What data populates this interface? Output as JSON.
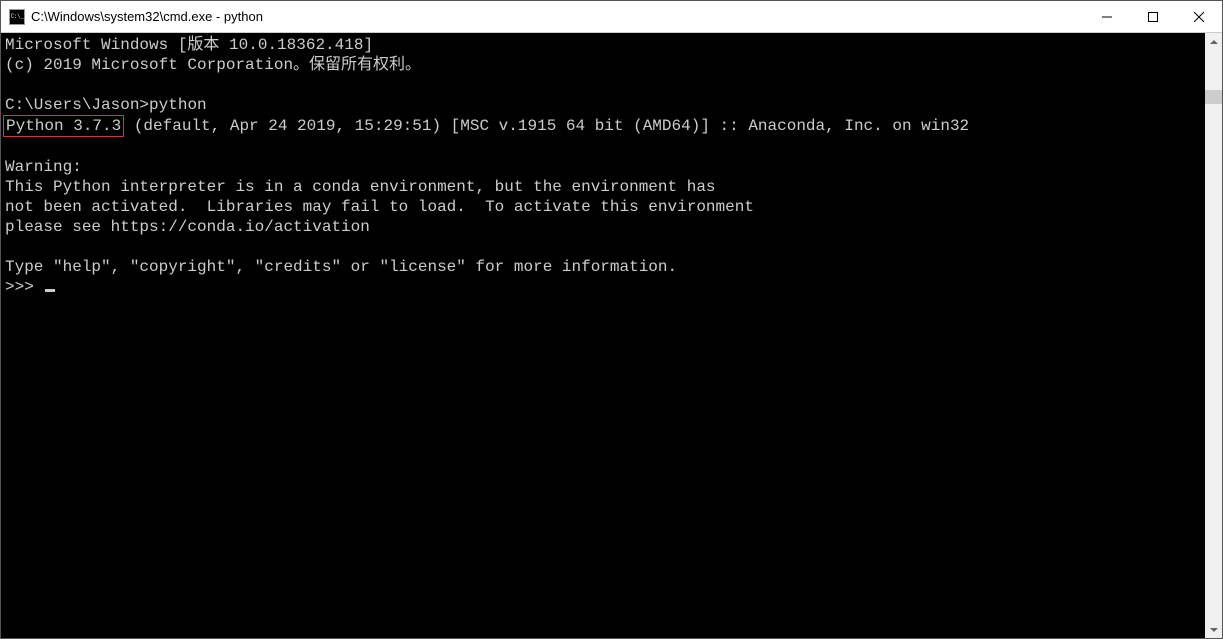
{
  "window": {
    "title": "C:\\Windows\\system32\\cmd.exe - python"
  },
  "terminal": {
    "banner1": "Microsoft Windows [版本 10.0.18362.418]",
    "banner2": "(c) 2019 Microsoft Corporation。保留所有权利。",
    "prompt_path": "C:\\Users\\Jason>",
    "prompt_cmd": "python",
    "py_version_highlight": "Python 3.7.3",
    "py_version_rest": " (default, Apr 24 2019, 15:29:51) [MSC v.1915 64 bit (AMD64)] :: Anaconda, Inc. on win32",
    "warn_heading": "Warning:",
    "warn_line1": "This Python interpreter is in a conda environment, but the environment has",
    "warn_line2": "not been activated.  Libraries may fail to load.  To activate this environment",
    "warn_line3": "please see https://conda.io/activation",
    "help_line": "Type \"help\", \"copyright\", \"credits\" or \"license\" for more information.",
    "repl_prompt": ">>> "
  }
}
